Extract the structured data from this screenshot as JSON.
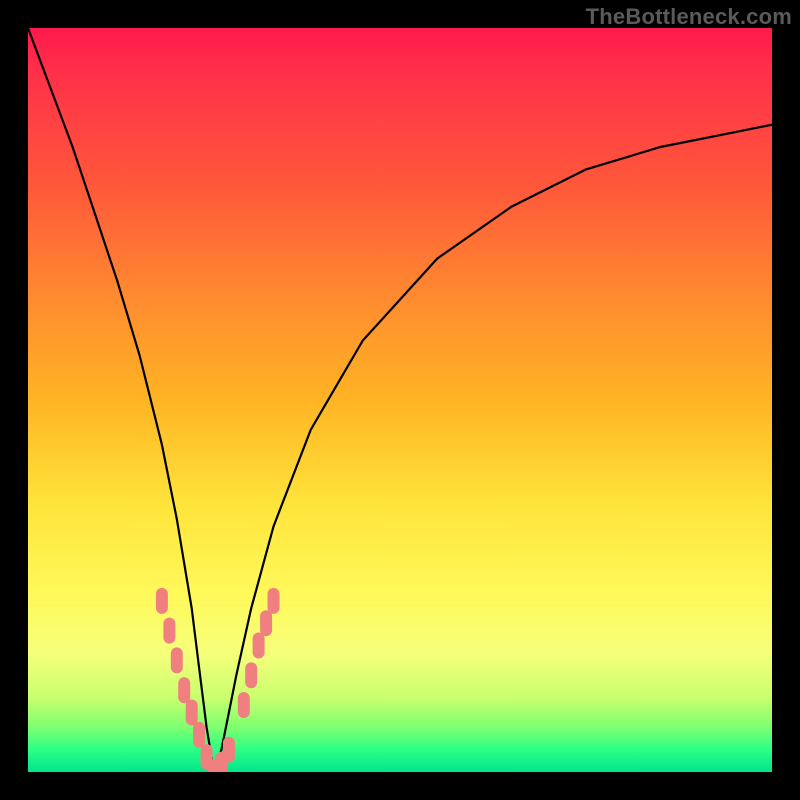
{
  "watermark": "TheBottleneck.com",
  "colors": {
    "gradient_top": "#ff1a4d",
    "gradient_bottom": "#00e58a",
    "curve": "#000000",
    "markers": "#f08080",
    "frame": "#000000"
  },
  "chart_data": {
    "type": "line",
    "title": "",
    "xlabel": "",
    "ylabel": "",
    "xlim": [
      0,
      100
    ],
    "ylim": [
      0,
      100
    ],
    "grid": false,
    "legend": false,
    "annotations": [],
    "description": "A single V-shaped bottleneck curve on a rainbow gradient background. Y axis encodes bottleneck severity (top = high/red, bottom = low/green). The curve plunges from the top-left edge to a minimum near x≈25 at y≈0, then rises asymptotically toward the upper-right. No axis ticks or numeric labels are rendered; values below are read by position relative to the plot area.",
    "series": [
      {
        "name": "bottleneck-curve",
        "x": [
          0,
          3,
          6,
          9,
          12,
          15,
          18,
          20,
          22,
          23,
          24,
          25,
          26,
          27,
          28,
          30,
          33,
          38,
          45,
          55,
          65,
          75,
          85,
          95,
          100
        ],
        "y": [
          100,
          92,
          84,
          75,
          66,
          56,
          44,
          34,
          22,
          14,
          6,
          0,
          3,
          8,
          13,
          22,
          33,
          46,
          58,
          69,
          76,
          81,
          84,
          86,
          87
        ]
      }
    ],
    "markers": {
      "name": "highlighted-range",
      "note": "Pill-shaped coral markers clustered along the curve near the bottom of the V (roughly x 17–33, y 0–22). Exact data values are not labeled on the chart.",
      "approx_points": [
        {
          "x": 18,
          "y": 23
        },
        {
          "x": 19,
          "y": 19
        },
        {
          "x": 20,
          "y": 15
        },
        {
          "x": 21,
          "y": 11
        },
        {
          "x": 22,
          "y": 8
        },
        {
          "x": 23,
          "y": 5
        },
        {
          "x": 24,
          "y": 2
        },
        {
          "x": 25,
          "y": 0
        },
        {
          "x": 26,
          "y": 1
        },
        {
          "x": 27,
          "y": 3
        },
        {
          "x": 29,
          "y": 9
        },
        {
          "x": 30,
          "y": 13
        },
        {
          "x": 31,
          "y": 17
        },
        {
          "x": 32,
          "y": 20
        },
        {
          "x": 33,
          "y": 23
        }
      ]
    }
  }
}
